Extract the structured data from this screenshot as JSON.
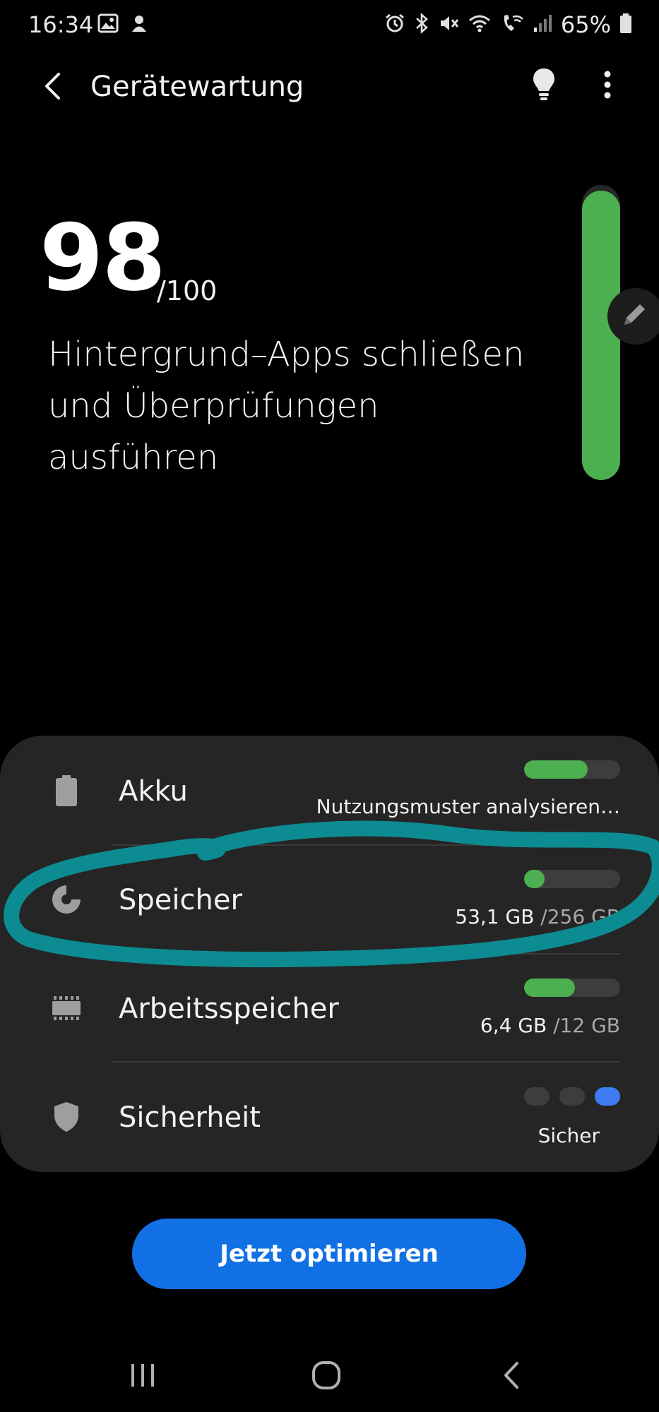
{
  "status_bar": {
    "time": "16:34",
    "battery_percent": "65%"
  },
  "header": {
    "title": "Gerätewartung"
  },
  "score": {
    "value": "98",
    "max": "/100",
    "level_fraction": 0.98,
    "description": "Hintergrund–Apps schließen und Überprüfungen ausführen",
    "gauge_color": "#4caf50"
  },
  "items": [
    {
      "label": "Akku",
      "icon": "battery-icon",
      "detail_main": "Nutzungsmuster analysieren…",
      "detail_muted": "",
      "fill_fraction": 0.66
    },
    {
      "label": "Speicher",
      "icon": "storage-pie-icon",
      "detail_main": "53,1 GB",
      "detail_muted": " /256 GB",
      "fill_fraction": 0.21
    },
    {
      "label": "Arbeitsspeicher",
      "icon": "memory-chip-icon",
      "detail_main": "6,4 GB",
      "detail_muted": " /12 GB",
      "fill_fraction": 0.53
    },
    {
      "label": "Sicherheit",
      "icon": "shield-icon",
      "detail_main": "Sicher",
      "detail_muted": "",
      "level": "3 of 3"
    }
  ],
  "action": {
    "optimize_label": "Jetzt optimieren",
    "color": "#1170e4"
  },
  "colors": {
    "good": "#4caf50",
    "track": "#3d3d3d",
    "secure_dot": "#3e7bf3",
    "annotation": "#0c8c92"
  }
}
